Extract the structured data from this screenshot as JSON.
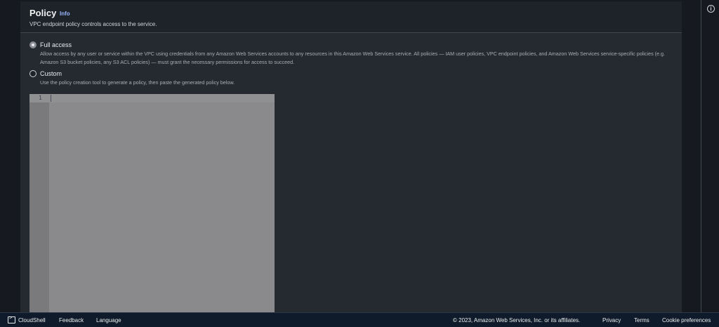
{
  "policy": {
    "title": "Policy",
    "info_link": "Info",
    "subtitle": "VPC endpoint policy controls access to the service.",
    "options": [
      {
        "label": "Full access",
        "selected": true,
        "description": "Allow access by any user or service within the VPC using credentials from any Amazon Web Services accounts to any resources in this Amazon Web Services service. All policies — IAM user policies, VPC endpoint policies, and Amazon Web Services service-specific policies (e.g. Amazon S3 bucket policies, any S3 ACL policies) — must grant the necessary permissions for access to succeed."
      },
      {
        "label": "Custom",
        "selected": false,
        "description": "Use the policy creation tool to generate a policy, then paste the generated policy below."
      }
    ],
    "editor": {
      "line_number": "1",
      "content": ""
    }
  },
  "right_rail": {
    "icon": "info-icon",
    "glyph": "i"
  },
  "footer": {
    "cloudshell": "CloudShell",
    "feedback": "Feedback",
    "language": "Language",
    "copyright": "© 2023, Amazon Web Services, Inc. or its affiliates.",
    "privacy": "Privacy",
    "terms": "Terms",
    "cookies": "Cookie preferences"
  }
}
